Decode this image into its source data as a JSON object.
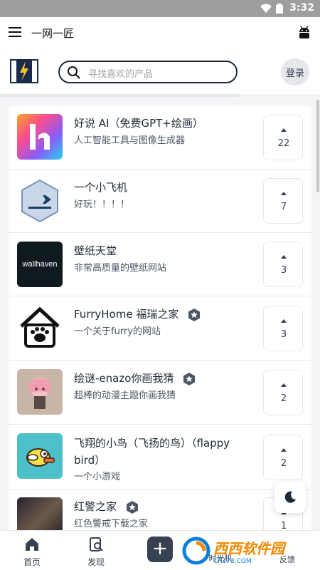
{
  "status": {
    "time": "3:32"
  },
  "app": {
    "title": "一网一匠"
  },
  "search": {
    "placeholder": "寻找喜欢的产品"
  },
  "header": {
    "login_label": "登录"
  },
  "products": [
    {
      "name": "好说 AI（免费GPT+绘画）",
      "desc": "人工智能工具与图像生成器",
      "votes": "22",
      "thumb_text": ""
    },
    {
      "name": "一个小飞机",
      "desc": "好玩！！！！",
      "votes": "7",
      "thumb_text": ""
    },
    {
      "name": "壁纸天堂",
      "desc": "非常高质量的壁纸网站",
      "votes": "3",
      "thumb_text": "wallhaven"
    },
    {
      "name": "FurryHome 福瑞之家",
      "desc": "一个关于furry的网站",
      "votes": "3",
      "thumb_text": ""
    },
    {
      "name": "绘谜-enazo你画我猜",
      "desc": "超棒的动漫主题你画我猜",
      "votes": "2",
      "thumb_text": ""
    },
    {
      "name": "飞翔的小鸟（飞扬的鸟）（flappy bird）",
      "desc": "一个小游戏",
      "votes": "2",
      "thumb_text": ""
    },
    {
      "name": "红警之家",
      "desc": "红色警戒下载之家",
      "votes": "1",
      "thumb_text": ""
    }
  ],
  "bottom_nav": {
    "home": "首页",
    "discover": "发现",
    "add": "+",
    "partial_4": "时光机",
    "partial_5": "反馈"
  },
  "watermark": {
    "main": "西西软件园",
    "sub": "CR173.COM"
  },
  "colors": {
    "accent": "#374151",
    "brand_orange": "#f08a00",
    "brand_blue": "#0b7fd9"
  }
}
